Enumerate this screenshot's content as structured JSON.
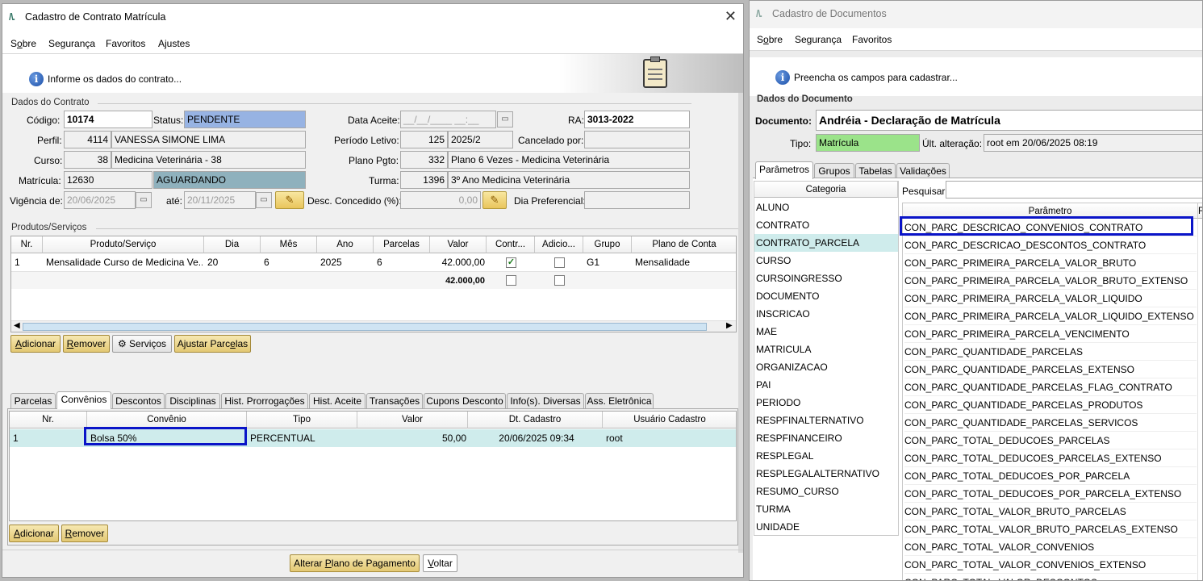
{
  "left_window": {
    "title": "Cadastro de Contrato Matrícula",
    "menu": [
      "Sobre",
      "Segurança",
      "Favoritos",
      "Ajustes"
    ],
    "info": "Informe os dados do contrato...",
    "group_contrato": "Dados do Contrato",
    "labels": {
      "codigo": "Código:",
      "status": "Status:",
      "data_aceite": "Data Aceite:",
      "ra": "RA:",
      "perfil": "Perfil:",
      "periodo_letivo": "Período Letivo:",
      "cancelado_por": "Cancelado por:",
      "curso": "Curso:",
      "plano_pgto": "Plano Pgto:",
      "matricula": "Matrícula:",
      "turma": "Turma:",
      "vigencia_de": "Vigência de:",
      "ate": "até:",
      "desc_concedido": "Desc. Concedido (%):",
      "dia_preferencial": "Dia Preferencial:"
    },
    "values": {
      "codigo": "10174",
      "status": "PENDENTE",
      "data_aceite": "__/__/____ __:__",
      "ra": "3013-2022",
      "perfil_code": "4114",
      "perfil_name": "VANESSA SIMONE LIMA",
      "periodo_code": "125",
      "periodo": "2025/2",
      "cancelado_por": "",
      "curso_code": "38",
      "curso_name": "Medicina Veterinária - 38",
      "plano_code": "332",
      "plano_name": "Plano 6 Vezes - Medicina Veterinária",
      "matricula_code": "12630",
      "matricula_status": "AGUARDANDO",
      "turma_code": "1396",
      "turma_name": "3º Ano Medicina Veterinária",
      "vigencia_de": "20/06/2025",
      "ate": "20/11/2025",
      "desc_concedido": "0,00",
      "dia_preferencial": ""
    },
    "group_produtos": "Produtos/Serviços",
    "produtos_headers": [
      "Nr.",
      "Produto/Serviço",
      "Dia",
      "Mês",
      "Ano",
      "Parcelas",
      "Valor",
      "Contr...",
      "Adicio...",
      "Grupo",
      "Plano de Conta"
    ],
    "produtos_row": {
      "nr": "1",
      "produto": "Mensalidade Curso de Medicina Ve...",
      "dia": "20",
      "mes": "6",
      "ano": "2025",
      "parcelas": "6",
      "valor": "42.000,00",
      "grupo": "G1",
      "plano": "Mensalidade"
    },
    "produtos_total": "42.000,00",
    "buttons_prod": [
      "Adicionar",
      "Remover",
      "Serviços",
      "Ajustar Parcelas"
    ],
    "tabs": [
      "Parcelas",
      "Convênios",
      "Descontos",
      "Disciplinas",
      "Hist. Prorrogações",
      "Hist. Aceite",
      "Transações",
      "Cupons Desconto",
      "Info(s). Diversas",
      "Ass. Eletrônica"
    ],
    "conv_headers": [
      "Nr.",
      "Convênio",
      "Tipo",
      "Valor",
      "Dt. Cadastro",
      "Usuário Cadastro"
    ],
    "conv_row": {
      "nr": "1",
      "convenio": "Bolsa 50%",
      "tipo": "PERCENTUAL",
      "valor": "50,00",
      "dt": "20/06/2025 09:34",
      "usuario": "root"
    },
    "buttons_conv": [
      "Adicionar",
      "Remover"
    ],
    "bottom_buttons": [
      "Alterar Plano de Pagamento",
      "Voltar"
    ]
  },
  "right_window": {
    "title": "Cadastro de Documentos",
    "menu": [
      "Sobre",
      "Segurança",
      "Favoritos"
    ],
    "info": "Preencha os campos para cadastrar...",
    "group": "Dados do Documento",
    "documento_label": "Documento:",
    "documento": "Andréia - Declaração de Matrícula",
    "tipo_label": "Tipo:",
    "tipo": "Matrícula",
    "ult_label": "Últ. alteração:",
    "ult": "root em 20/06/2025 08:19",
    "tabs": [
      "Parâmetros",
      "Grupos",
      "Tabelas",
      "Validações"
    ],
    "categoria_header": "Categoria",
    "categorias": [
      "ALUNO",
      "CONTRATO",
      "CONTRATO_PARCELA",
      "CURSO",
      "CURSOINGRESSO",
      "DOCUMENTO",
      "INSCRICAO",
      "MAE",
      "MATRICULA",
      "ORGANIZACAO",
      "PAI",
      "PERIODO",
      "RESPFINALTERNATIVO",
      "RESPFINANCEIRO",
      "RESPLEGAL",
      "RESPLEGALALTERNATIVO",
      "RESUMO_CURSO",
      "TURMA",
      "UNIDADE"
    ],
    "pesquisar": "Pesquisar:",
    "parametro_header": "Parâmetro",
    "parametro_header2": "F",
    "parametros": [
      "CON_PARC_DESCRICAO_CONVENIOS_CONTRATO",
      "CON_PARC_DESCRICAO_DESCONTOS_CONTRATO",
      "CON_PARC_PRIMEIRA_PARCELA_VALOR_BRUTO",
      "CON_PARC_PRIMEIRA_PARCELA_VALOR_BRUTO_EXTENSO",
      "CON_PARC_PRIMEIRA_PARCELA_VALOR_LIQUIDO",
      "CON_PARC_PRIMEIRA_PARCELA_VALOR_LIQUIDO_EXTENSO",
      "CON_PARC_PRIMEIRA_PARCELA_VENCIMENTO",
      "CON_PARC_QUANTIDADE_PARCELAS",
      "CON_PARC_QUANTIDADE_PARCELAS_EXTENSO",
      "CON_PARC_QUANTIDADE_PARCELAS_FLAG_CONTRATO",
      "CON_PARC_QUANTIDADE_PARCELAS_PRODUTOS",
      "CON_PARC_QUANTIDADE_PARCELAS_SERVICOS",
      "CON_PARC_TOTAL_DEDUCOES_PARCELAS",
      "CON_PARC_TOTAL_DEDUCOES_PARCELAS_EXTENSO",
      "CON_PARC_TOTAL_DEDUCOES_POR_PARCELA",
      "CON_PARC_TOTAL_DEDUCOES_POR_PARCELA_EXTENSO",
      "CON_PARC_TOTAL_VALOR_BRUTO_PARCELAS",
      "CON_PARC_TOTAL_VALOR_BRUTO_PARCELAS_EXTENSO",
      "CON_PARC_TOTAL_VALOR_CONVENIOS",
      "CON_PARC_TOTAL_VALOR_CONVENIOS_EXTENSO",
      "CON_PARC_TOTAL_VALOR_DESCONTOS"
    ]
  },
  "colors": {
    "status_bg": "#97b3e3",
    "aguardando_bg": "#8fb1bd",
    "tipo_bg": "#9be38a",
    "selected_row": "#cfecec",
    "highlight": "#0a14c8"
  }
}
